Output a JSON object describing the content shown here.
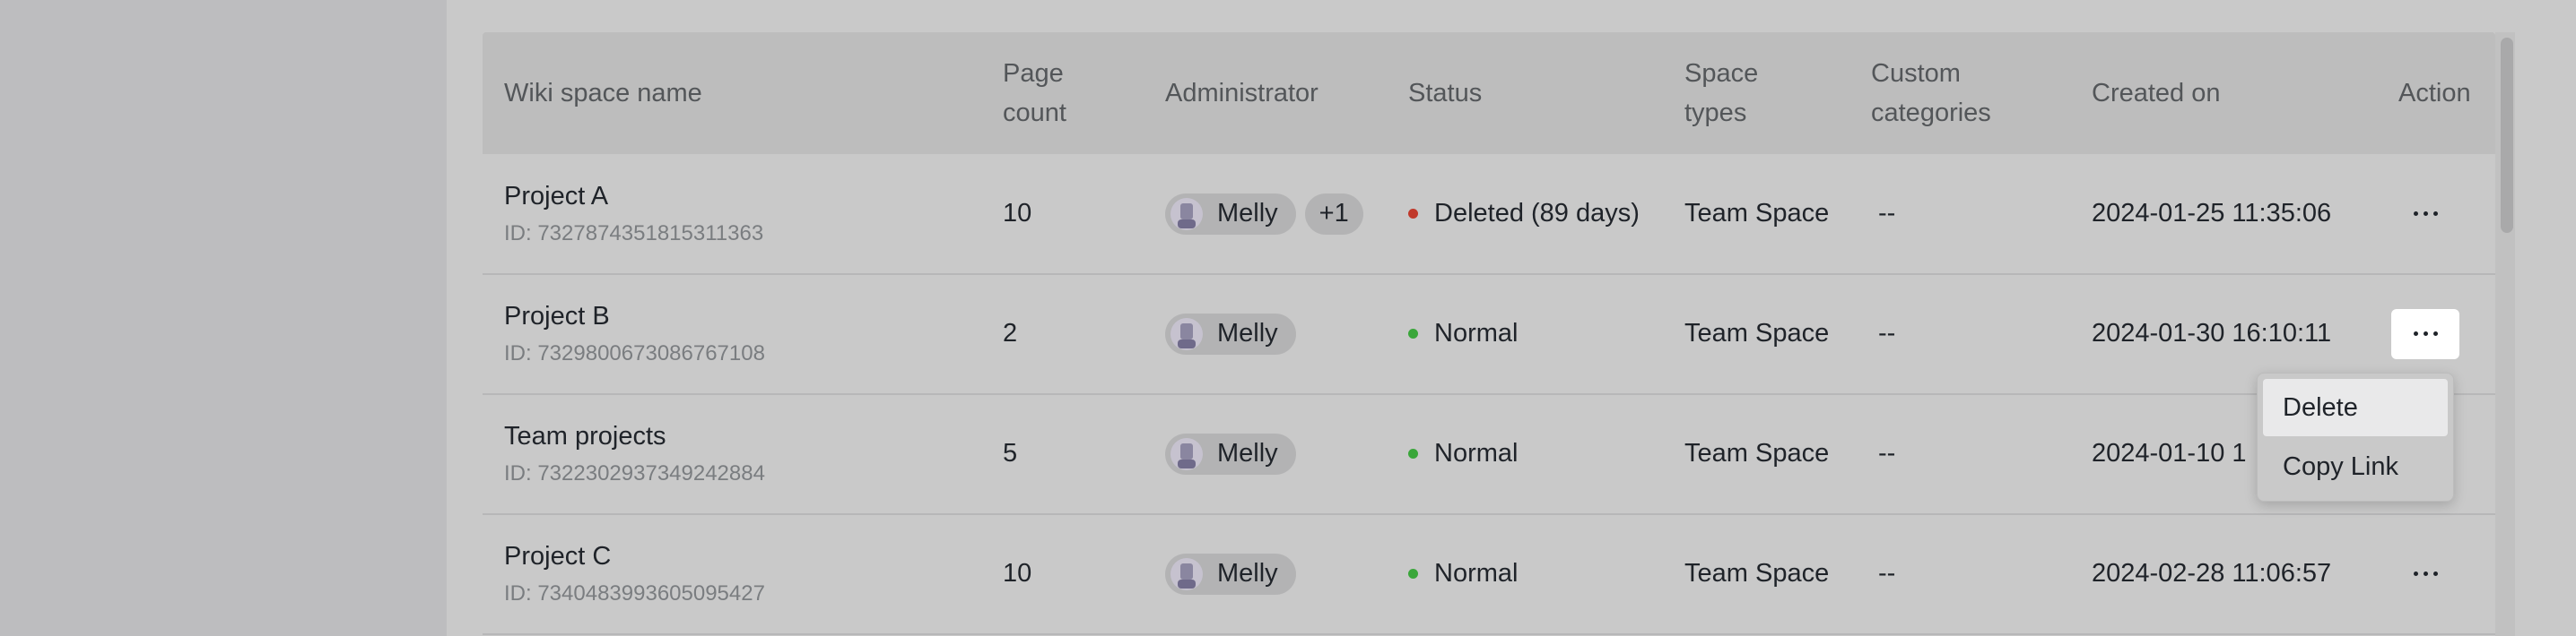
{
  "table": {
    "headers": {
      "name": "Wiki space name",
      "page_count_1": "Page",
      "page_count_2": "count",
      "admin": "Administrator",
      "status": "Status",
      "space_types_1": "Space",
      "space_types_2": "types",
      "custom_1": "Custom",
      "custom_2": "categories",
      "created": "Created on",
      "action": "Action"
    },
    "rows": [
      {
        "name": "Project A",
        "id": "ID: 7327874351815311363",
        "page_count": "10",
        "admin": "Melly",
        "admin_extra": "+1",
        "status": "Deleted (89 days)",
        "status_color": "#c0392b",
        "space_type": "Team Space",
        "custom": "--",
        "created": "2024-01-25 11:35:06"
      },
      {
        "name": "Project B",
        "id": "ID: 7329800673086767108",
        "page_count": "2",
        "admin": "Melly",
        "status": "Normal",
        "status_color": "#3aa63a",
        "space_type": "Team Space",
        "custom": "--",
        "created": "2024-01-30 16:10:11"
      },
      {
        "name": "Team projects",
        "id": "ID: 7322302937349242884",
        "page_count": "5",
        "admin": "Melly",
        "status": "Normal",
        "status_color": "#3aa63a",
        "space_type": "Team Space",
        "custom": "--",
        "created": "2024-01-10 1"
      },
      {
        "name": "Project C",
        "id": "ID: 7340483993605095427",
        "page_count": "10",
        "admin": "Melly",
        "status": "Normal",
        "status_color": "#3aa63a",
        "space_type": "Team Space",
        "custom": "--",
        "created": "2024-02-28 11:06:57"
      }
    ]
  },
  "dropdown": {
    "delete": "Delete",
    "copy_link": "Copy Link"
  },
  "icons": {
    "action": "more-horizontal-icon",
    "avatar": "user-avatar-icon"
  }
}
